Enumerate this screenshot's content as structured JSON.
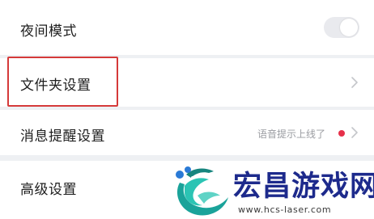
{
  "settings": {
    "items": [
      {
        "label": "夜间模式",
        "control": "toggle",
        "toggle_on": false
      },
      {
        "label": "文件夹设置",
        "control": "chevron",
        "highlighted": true
      },
      {
        "label": "消息提醒设置",
        "control": "chevron",
        "status_text": "语音提示上线了",
        "badge_color": "#e6304a"
      },
      {
        "label": "高级设置",
        "control": "none"
      }
    ]
  },
  "watermark": {
    "title": "宏昌游戏网",
    "url": "www.hcs-laser.com",
    "logo": "dragon-logo-icon"
  },
  "colors": {
    "highlight": "#d53a3a",
    "badge": "#e6304a",
    "watermark_title": "#1d2a8c",
    "logo_teal": "#1aa39a",
    "background": "#eef0f3"
  }
}
